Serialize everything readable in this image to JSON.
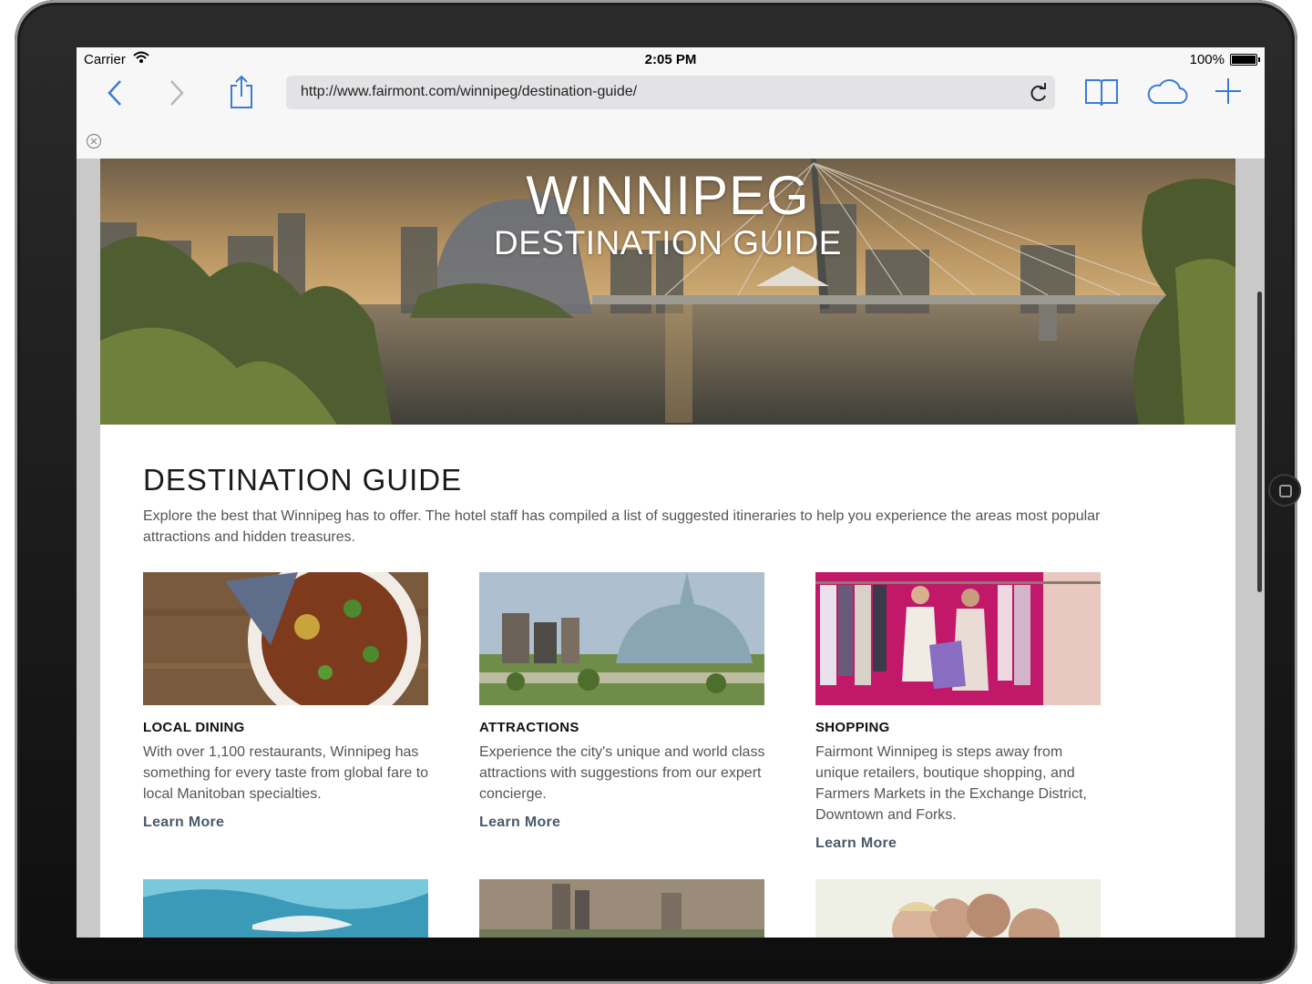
{
  "status_bar": {
    "carrier": "Carrier",
    "time": "2:05 PM",
    "battery": "100%"
  },
  "browser": {
    "url": "http://www.fairmont.com/winnipeg/destination-guide/",
    "icons": [
      "back-icon",
      "forward-icon",
      "share-icon",
      "reload-icon",
      "bookmarks-icon",
      "cloud-icon",
      "add-tab-icon",
      "close-banner-icon"
    ]
  },
  "hero": {
    "title": "WINNIPEG",
    "subtitle": "DESTINATION GUIDE"
  },
  "main": {
    "heading": "DESTINATION GUIDE",
    "intro": "Explore the best that Winnipeg has to offer. The hotel staff has compiled a list of suggested itineraries to help you experience the areas most popular attractions and hidden treasures.",
    "cards": [
      {
        "title": "LOCAL DINING",
        "text": "With over 1,100 restaurants, Winnipeg has something for every taste from global fare to local Manitoban specialties.",
        "link": "Learn More"
      },
      {
        "title": "ATTRACTIONS",
        "text": "Experience the city's unique and world class attractions with suggestions from our expert concierge.",
        "link": "Learn More"
      },
      {
        "title": "SHOPPING",
        "text": "Fairmont Winnipeg is steps away from unique retailers, boutique shopping, and Farmers Markets in the Exchange District, Downtown and Forks.",
        "link": "Learn More"
      }
    ]
  },
  "colors": {
    "link": "#4a5a6a",
    "ios_blue": "#3a7bd5",
    "shopping_wall": "#c2186a"
  }
}
